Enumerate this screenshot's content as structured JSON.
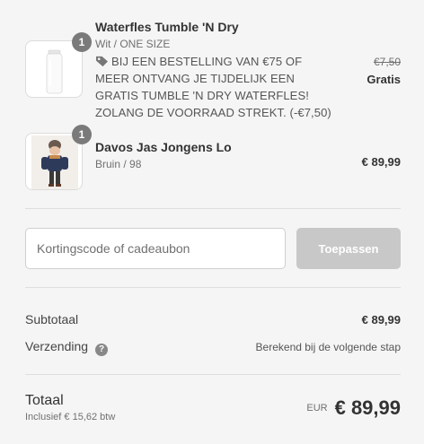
{
  "items": [
    {
      "quantity": "1",
      "title": "Waterfles Tumble 'N Dry",
      "variant": "Wit / ONE SIZE",
      "promo": "BIJ EEN BESTELLING VAN €75 OF MEER ONTVANG JE TIJDELIJK EEN GRATIS TUMBLE 'N DRY WATERFLES! ZOLANG DE VOORRAAD STREKT. (-€7,50)",
      "original_price": "€7,50",
      "price": "Gratis"
    },
    {
      "quantity": "1",
      "title": "Davos Jas Jongens Lo",
      "variant": "Bruin / 98",
      "price": "€ 89,99"
    }
  ],
  "discount": {
    "placeholder": "Kortingscode of cadeaubon",
    "apply_label": "Toepassen"
  },
  "summary": {
    "subtotal_label": "Subtotaal",
    "subtotal_value": "€ 89,99",
    "shipping_label": "Verzending",
    "shipping_help": "?",
    "shipping_value": "Berekend bij de volgende stap",
    "total_label": "Totaal",
    "tax_note": "Inclusief € 15,62 btw",
    "currency": "EUR",
    "total_value": "€ 89,99"
  },
  "icons": {
    "tag": "tag-icon",
    "help": "question-icon"
  }
}
